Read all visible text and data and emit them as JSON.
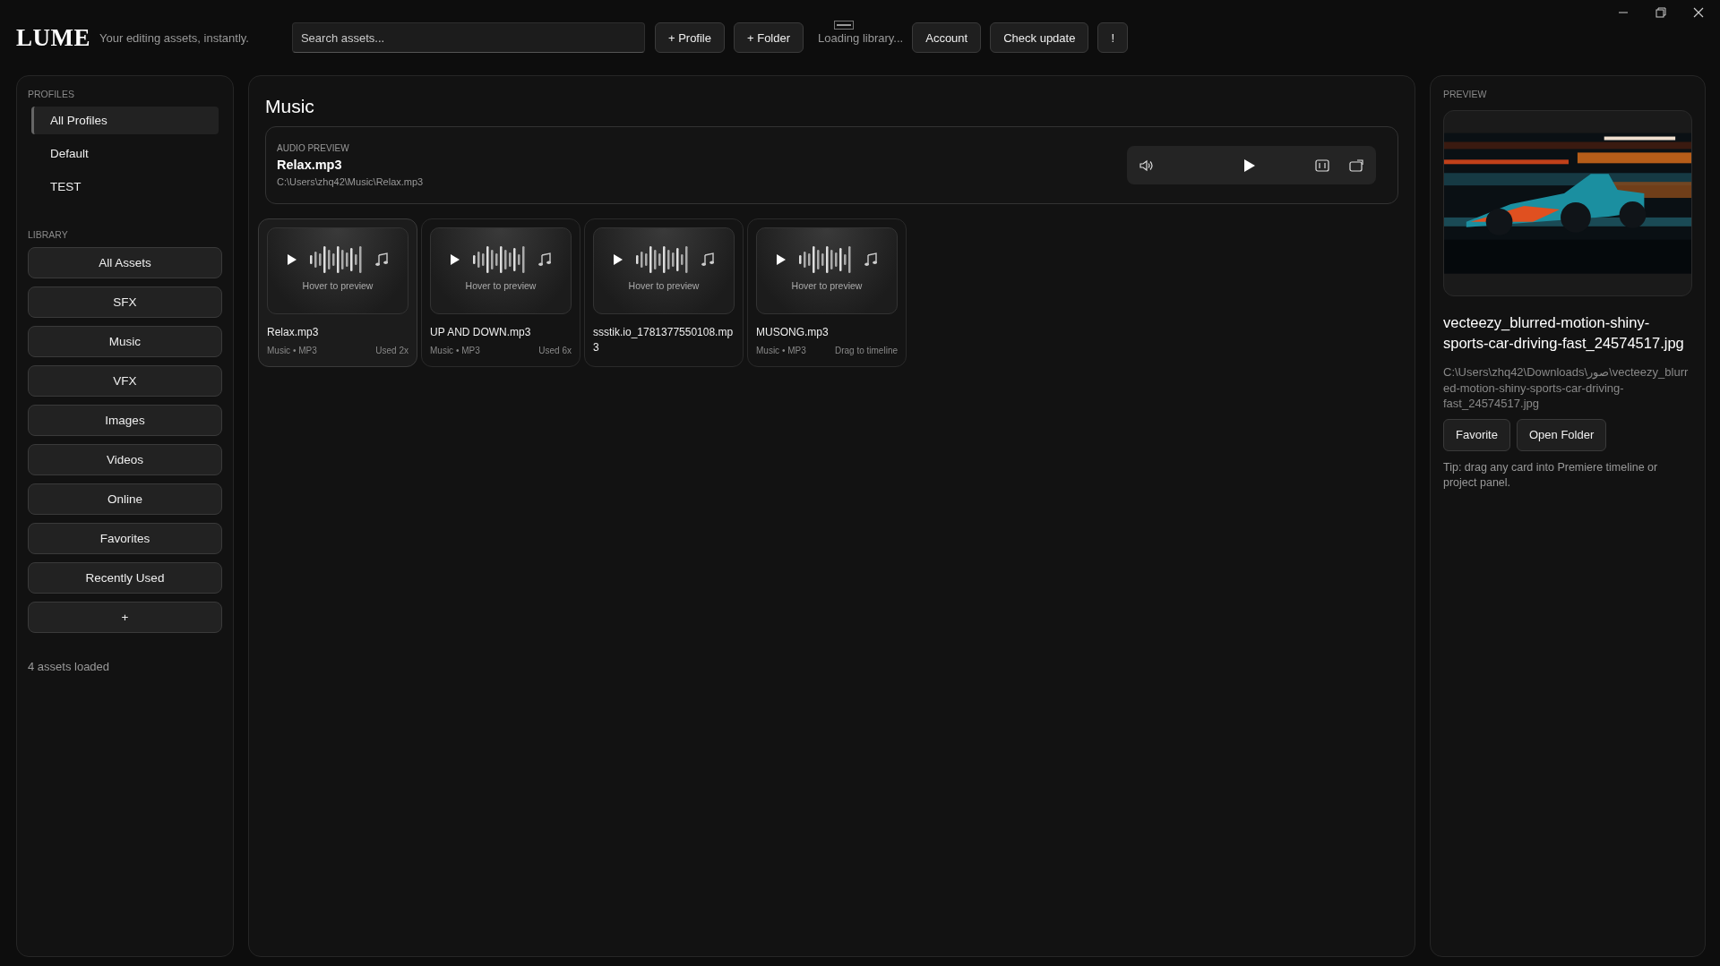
{
  "app": {
    "logo": "LUME",
    "tagline": "Your editing assets, instantly."
  },
  "toolbar": {
    "search": {
      "placeholder": "Search assets..."
    },
    "buttons": [
      "+ Profile",
      "+ Folder"
    ],
    "status": "Loading library...",
    "actions": [
      "Account",
      "Check update",
      "!"
    ]
  },
  "sidebar": {
    "profiles_heading": "PROFILES",
    "profiles": [
      {
        "label": "All Profiles",
        "selected": true
      },
      {
        "label": "Default",
        "selected": false
      },
      {
        "label": "TEST",
        "selected": false
      }
    ],
    "library_heading": "LIBRARY",
    "library": [
      "All Assets",
      "SFX",
      "Music",
      "VFX",
      "Images",
      "Videos",
      "Online",
      "Favorites",
      "Recently Used",
      "+"
    ],
    "footer": "4 assets loaded"
  },
  "main": {
    "title": "Music",
    "audio_preview": {
      "heading": "AUDIO PREVIEW",
      "name": "Relax.mp3",
      "path": "C:\\Users\\zhq42\\Music\\Relax.mp3"
    },
    "cards": [
      {
        "name": "Relax.mp3",
        "meta": "Music • MP3",
        "note": "Used 2x",
        "thumb_label": "Hover to preview",
        "selected": true
      },
      {
        "name": "UP AND DOWN.mp3",
        "meta": "Music • MP3",
        "note": "Used 6x",
        "thumb_label": "Hover to preview",
        "selected": false
      },
      {
        "name": "ssstik.io_1781377550108.mp3",
        "thumb_label": "Hover to preview",
        "selected": false
      },
      {
        "name": "MUSONG.mp3",
        "meta": "Music • MP3",
        "note": "Drag to timeline",
        "thumb_label": "Hover to preview",
        "selected": false
      }
    ]
  },
  "preview": {
    "heading": "PREVIEW",
    "image": {
      "kind": "picture"
    },
    "name": "vecteezy_blurred-motion-shiny-sports-car-driving-fast_24574517.jpg",
    "path": "C:\\Users\\zhq42\\Downloads\\صور\\vecteezy_blurred-motion-shiny-sports-car-driving-fast_24574517.jpg",
    "buttons": [
      "Favorite",
      "Open Folder"
    ],
    "tip": "Tip: drag any card into Premiere timeline or project panel."
  }
}
